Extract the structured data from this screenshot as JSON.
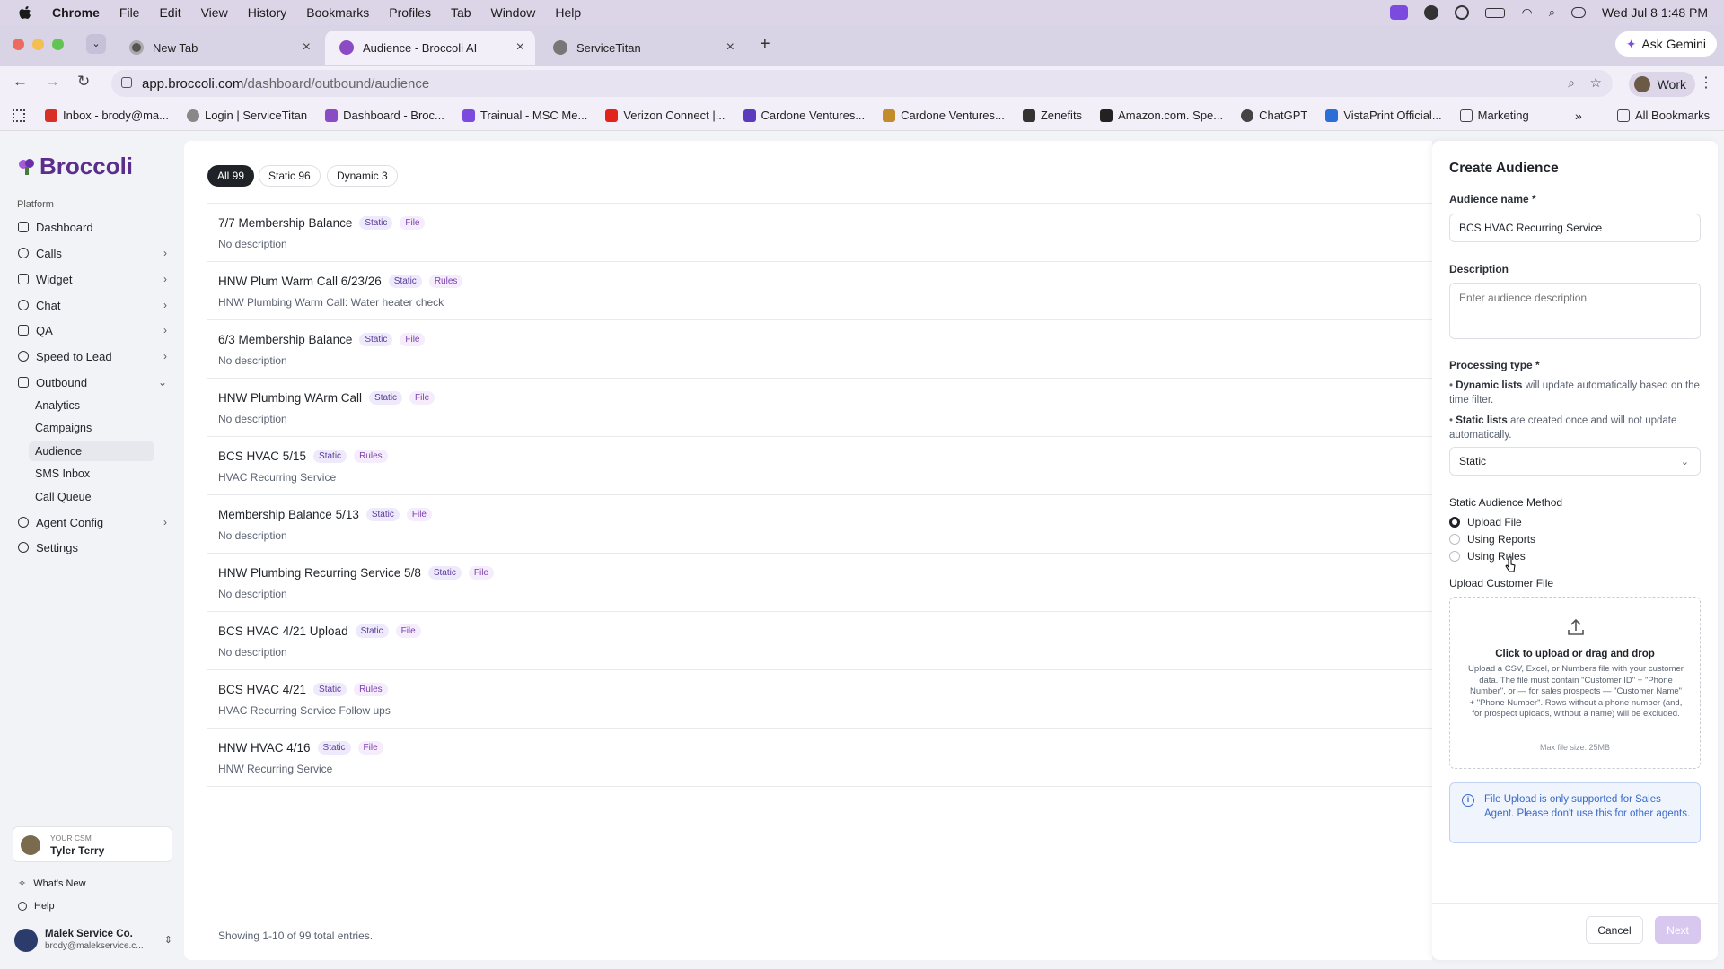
{
  "menubar": {
    "app": "Chrome",
    "items": [
      "File",
      "Edit",
      "View",
      "History",
      "Bookmarks",
      "Profiles",
      "Tab",
      "Window",
      "Help"
    ],
    "datetime": "Wed Jul 8  1:48 PM"
  },
  "tabs": [
    {
      "label": "New Tab",
      "icon": "chrome-icon"
    },
    {
      "label": "Audience - Broccoli AI",
      "icon": "broccoli-icon"
    },
    {
      "label": "ServiceTitan",
      "icon": "servicetitan-icon"
    }
  ],
  "toolbar": {
    "url_host": "app.broccoli.com",
    "url_path": "/dashboard/outbound/audience",
    "ask_gemini": "Ask Gemini",
    "profile": "Work"
  },
  "bookmarks": [
    "Inbox - brody@ma...",
    "Login | ServiceTitan",
    "Dashboard - Broc...",
    "Trainual - MSC Me...",
    "Verizon Connect |...",
    "Cardone Ventures...",
    "Cardone Ventures...",
    "Zenefits",
    "Amazon.com. Spe...",
    "ChatGPT",
    "VistaPrint Official...",
    "Marketing"
  ],
  "all_bookmarks": "All Bookmarks",
  "sidebar": {
    "logo": "Broccoli",
    "section": "Platform",
    "items": [
      {
        "label": "Dashboard"
      },
      {
        "label": "Calls"
      },
      {
        "label": "Widget"
      },
      {
        "label": "Chat"
      },
      {
        "label": "QA"
      },
      {
        "label": "Speed to Lead"
      },
      {
        "label": "Outbound"
      }
    ],
    "outbound_sub": [
      "Analytics",
      "Campaigns",
      "Audience",
      "SMS Inbox",
      "Call Queue"
    ],
    "agent_config": "Agent Config",
    "settings": "Settings",
    "csm_label": "YOUR CSM",
    "csm_name": "Tyler Terry",
    "whats_new": "What's New",
    "help": "Help",
    "org_name": "Malek Service Co.",
    "org_email": "brody@malekservice.c..."
  },
  "filters": [
    "All 99",
    "Static 96",
    "Dynamic 3"
  ],
  "audiences": [
    {
      "name": "7/7 Membership Balance",
      "type": "Static",
      "source": "File",
      "desc": "No description"
    },
    {
      "name": "HNW Plum Warm Call 6/23/26",
      "type": "Static",
      "source": "Rules",
      "desc": "HNW Plumbing Warm Call: Water heater check"
    },
    {
      "name": "6/3 Membership Balance",
      "type": "Static",
      "source": "File",
      "desc": "No description"
    },
    {
      "name": "HNW Plumbing WArm Call",
      "type": "Static",
      "source": "File",
      "desc": "No description"
    },
    {
      "name": "BCS HVAC 5/15",
      "type": "Static",
      "source": "Rules",
      "desc": "HVAC Recurring Service"
    },
    {
      "name": "Membership Balance 5/13",
      "type": "Static",
      "source": "File",
      "desc": "No description"
    },
    {
      "name": "HNW Plumbing Recurring Service 5/8",
      "type": "Static",
      "source": "File",
      "desc": "No description"
    },
    {
      "name": "BCS HVAC 4/21 Upload",
      "type": "Static",
      "source": "File",
      "desc": "No description"
    },
    {
      "name": "BCS HVAC 4/21",
      "type": "Static",
      "source": "Rules",
      "desc": "HVAC Recurring Service Follow ups"
    },
    {
      "name": "HNW HVAC 4/16",
      "type": "Static",
      "source": "File",
      "desc": "HNW Recurring Service"
    }
  ],
  "showing": "Showing 1-10 of 99 total entries.",
  "panel": {
    "title": "Create Audience",
    "name_label": "Audience name",
    "required": "*",
    "name_value": "BCS HVAC Recurring Service",
    "desc_label": "Description",
    "desc_placeholder": "Enter audience description",
    "proc_label": "Processing type",
    "dynamic_bold": "Dynamic lists",
    "dynamic_text": " will update automatically based on the time filter.",
    "static_bold": "Static lists",
    "static_text": " are created once and will not update automatically.",
    "proc_value": "Static",
    "method_label": "Static Audience Method",
    "methods": [
      "Upload File",
      "Using Reports",
      "Using Rules"
    ],
    "selected_method": 0,
    "upload_label": "Upload Customer File",
    "upload_title": "Click to upload or drag and drop",
    "upload_desc": "Upload a CSV, Excel, or Numbers file with your customer data. The file must contain \"Customer ID\" + \"Phone Number\", or — for sales prospects — \"Customer Name\" + \"Phone Number\". Rows without a phone number (and, for prospect uploads, without a name) will be excluded.",
    "upload_max": "Max file size: 25MB",
    "info": "File Upload is only supported for Sales Agent. Please don't use this for other agents.",
    "cancel": "Cancel",
    "next": "Next"
  },
  "colors": {
    "brand": "#5b2d8c",
    "info": "#3b69c7",
    "next_disabled": "#d8c7ef"
  }
}
